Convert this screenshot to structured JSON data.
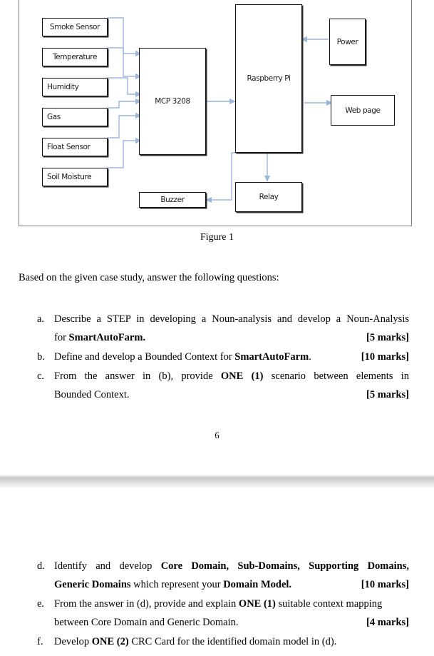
{
  "document": {
    "figure": {
      "caption": "Figure 1",
      "blocks": [
        {
          "id": "smoke-sensor",
          "label": "Smoke Sensor"
        },
        {
          "id": "temperature",
          "label": "Temperature"
        },
        {
          "id": "humidity",
          "label": "Humidity"
        },
        {
          "id": "gas",
          "label": "Gas"
        },
        {
          "id": "float-sensor",
          "label": "Float Sensor"
        },
        {
          "id": "soil-moisture",
          "label": "Soil Moisture"
        },
        {
          "id": "mcp-3208",
          "label": "MCP 3208"
        },
        {
          "id": "raspberry-pi",
          "label": "Raspberry Pi"
        },
        {
          "id": "power",
          "label": "Power"
        },
        {
          "id": "web-page",
          "label": "Web page"
        },
        {
          "id": "buzzer",
          "label": "Buzzer"
        },
        {
          "id": "relay",
          "label": "Relay"
        }
      ],
      "wire_color": "#9cb6dc",
      "block_border_color": "#111111",
      "frame_border_color": "#808080"
    },
    "intro": "Based on the given case study, answer the following questions:",
    "page_one_number": "6",
    "questions": [
      {
        "marker": "a.",
        "line1": "Describe a STEP in developing a Noun-analysis and develop a Noun-Analysis",
        "line2_pre": "for ",
        "line2_bold": "SmartAutoFarm.",
        "marks": "[5 marks]"
      },
      {
        "marker": "b.",
        "line1_pre": "Define and develop a Bounded Context for ",
        "line1_bold": "SmartAutoFarm",
        "line1_post": ".",
        "marks": "[10 marks]"
      },
      {
        "marker": "c.",
        "line1_pre": "From the answer in (b), provide ",
        "line1_bold": "ONE (1)",
        "line1_post": " scenario between elements in",
        "line2": "Bounded Context.",
        "marks": "[5 marks]"
      },
      {
        "marker": "d.",
        "line1_pre": "Identify and develop ",
        "line1_bold": "Core Domain, Sub-Domains, Supporting Domains,",
        "line2_bold_a": "Generic Domains",
        "line2_mid": " which represent your ",
        "line2_bold_b": "Domain Model.",
        "marks": "[10 marks]"
      },
      {
        "marker": "e.",
        "line1_pre": "From the answer in (d), provide and explain ",
        "line1_bold": "ONE (1)",
        "line1_post": " suitable context mapping",
        "line2": "between Core Domain and Generic Domain.",
        "marks": "[4 marks]"
      },
      {
        "marker": "f.",
        "line1_pre": "Develop  ",
        "line1_bold": "ONE (2)",
        "line1_post": " CRC Card for the identified domain model in (d)."
      }
    ]
  }
}
